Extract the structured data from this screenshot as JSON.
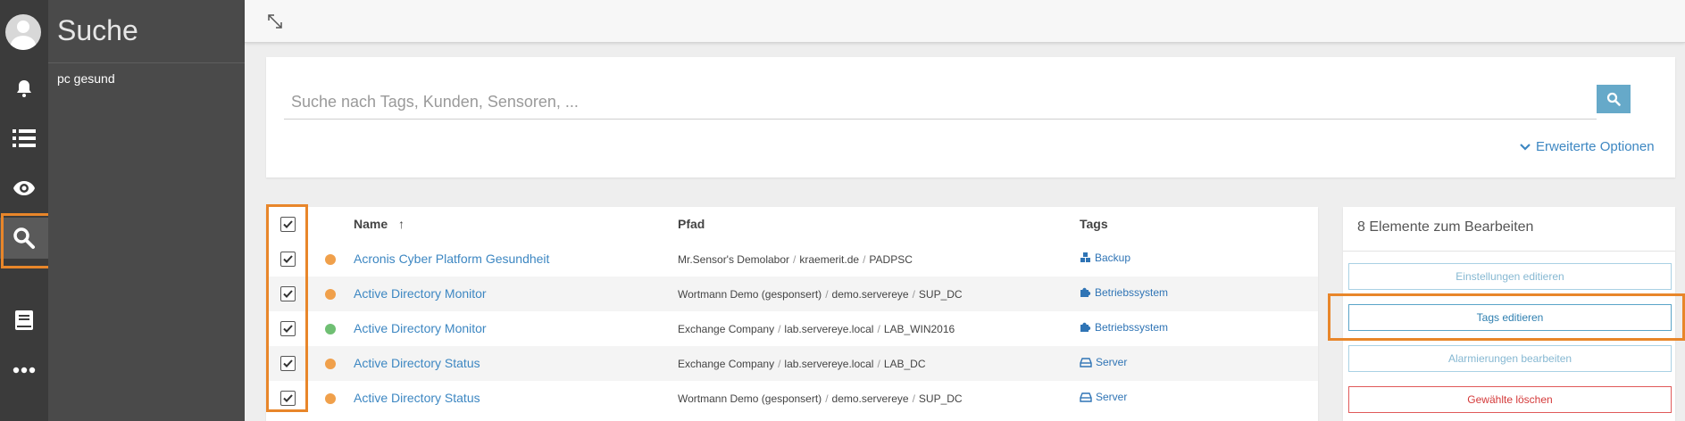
{
  "app": {
    "panel_title": "Suche",
    "panel_item": "pc gesund"
  },
  "rail": {
    "icons": [
      "user-avatar-icon",
      "bell-icon",
      "list-icon",
      "eye-icon",
      "search-icon",
      "book-icon",
      "more-icon"
    ],
    "active": "search-icon"
  },
  "search": {
    "placeholder": "Suche nach Tags, Kunden, Sensoren, ...",
    "value": "",
    "advanced_label": "Erweiterte Optionen"
  },
  "table": {
    "headers": {
      "name": "Name",
      "path": "Pfad",
      "tags": "Tags"
    },
    "sort_indicator": "↑",
    "rows": [
      {
        "checked": true,
        "status_color": "#f0a04b",
        "name": "Acronis Cyber Platform Gesundheit",
        "path": [
          "Mr.Sensor's Demolabor",
          "kraemerit.de",
          "PADPSC"
        ],
        "tag": "Backup",
        "tag_icon": "cubes-icon"
      },
      {
        "checked": true,
        "status_color": "#f0a04b",
        "name": "Active Directory Monitor",
        "path": [
          "Wortmann Demo (gesponsert)",
          "demo.servereye",
          "SUP_DC"
        ],
        "tag": "Betriebssystem",
        "tag_icon": "puzzle-icon"
      },
      {
        "checked": true,
        "status_color": "#6fbf73",
        "name": "Active Directory Monitor",
        "path": [
          "Exchange Company",
          "lab.servereye.local",
          "LAB_WIN2016"
        ],
        "tag": "Betriebssystem",
        "tag_icon": "puzzle-icon"
      },
      {
        "checked": true,
        "status_color": "#f0a04b",
        "name": "Active Directory Status",
        "path": [
          "Exchange Company",
          "lab.servereye.local",
          "LAB_DC"
        ],
        "tag": "Server",
        "tag_icon": "drive-icon"
      },
      {
        "checked": true,
        "status_color": "#f0a04b",
        "name": "Active Directory Status",
        "path": [
          "Wortmann Demo (gesponsert)",
          "demo.servereye",
          "SUP_DC"
        ],
        "tag": "Server",
        "tag_icon": "drive-icon"
      }
    ]
  },
  "bulk": {
    "title": "8 Elemente zum Bearbeiten",
    "edit_settings": "Einstellungen editieren",
    "edit_tags": "Tags editieren",
    "edit_alerts": "Alarmierungen bearbeiten",
    "delete_selected": "Gewählte löschen"
  },
  "colors": {
    "accent": "#3d87c2",
    "highlight": "#e8862a",
    "warning_dot": "#f0a04b",
    "ok_dot": "#6fbf73",
    "danger": "#d43a3a"
  }
}
